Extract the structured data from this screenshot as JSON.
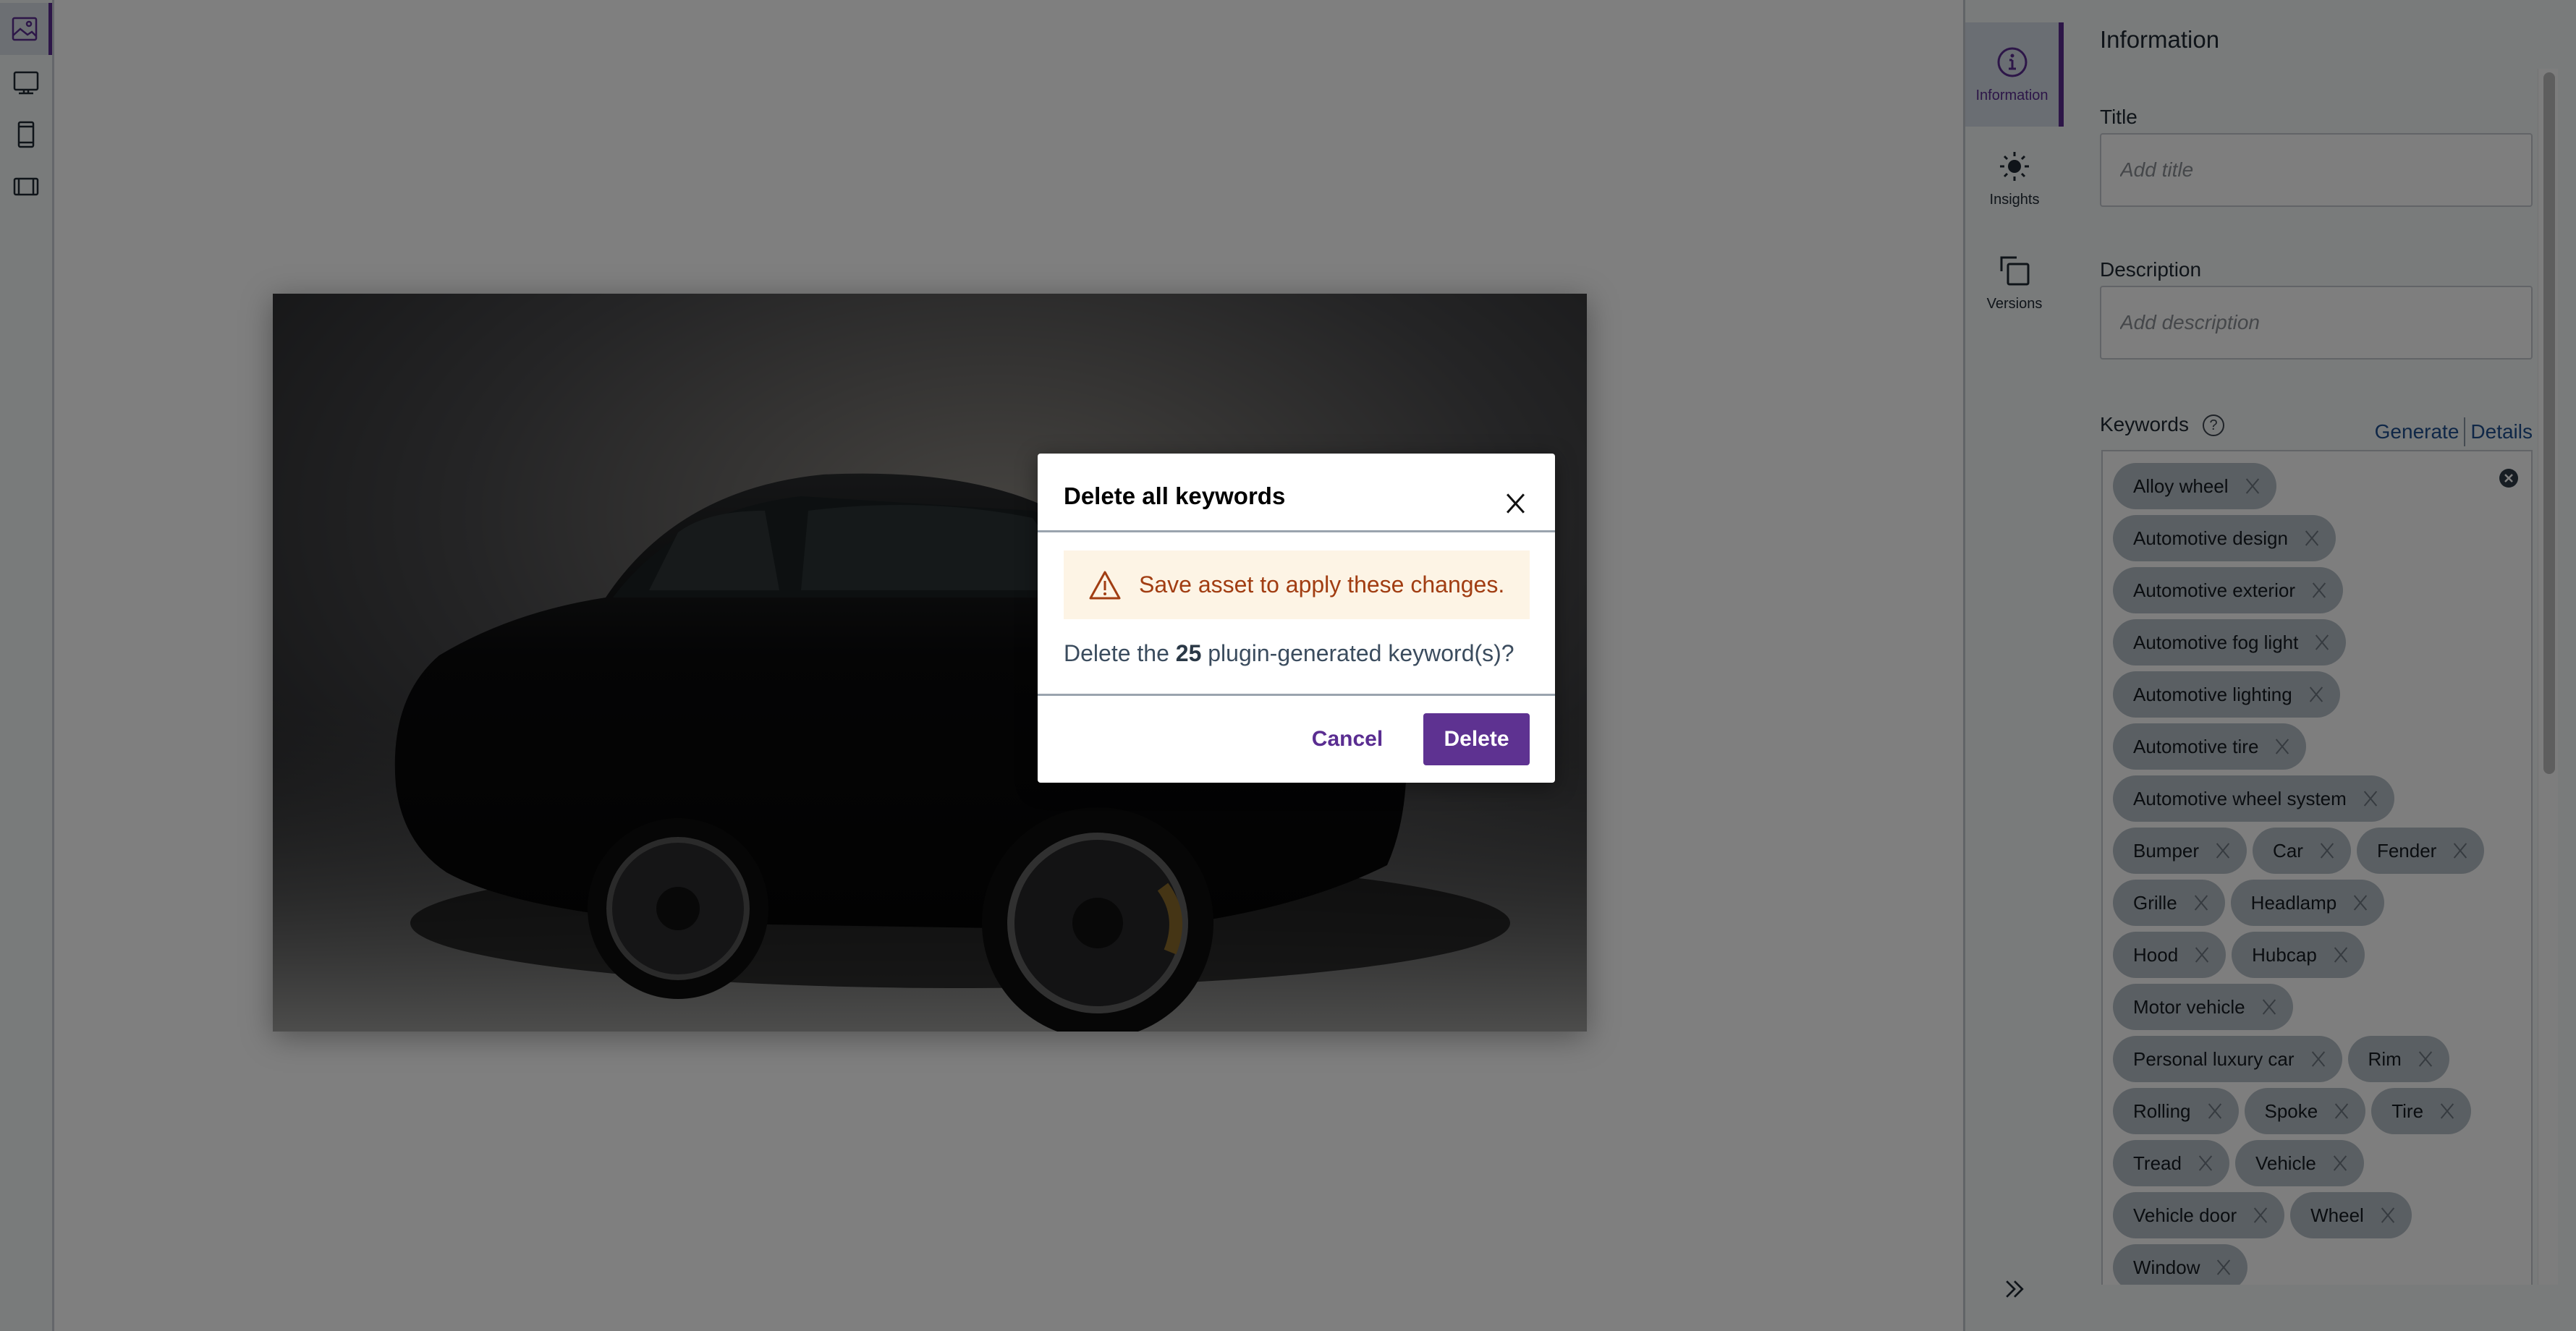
{
  "left_toolbar": {
    "items": [
      {
        "icon": "image-icon",
        "active": true
      },
      {
        "icon": "desktop-icon",
        "active": false
      },
      {
        "icon": "tablet-icon",
        "active": false
      },
      {
        "icon": "film-frame-icon",
        "active": false
      }
    ]
  },
  "canvas": {
    "asset_image": {
      "subject": "Black classic sports car on dark studio background"
    }
  },
  "rail": {
    "items": [
      {
        "label": "Information",
        "icon": "info-icon",
        "active": true
      },
      {
        "label": "Insights",
        "icon": "sun-icon",
        "active": false
      },
      {
        "label": "Versions",
        "icon": "versions-icon",
        "active": false
      }
    ],
    "collapse_icon": "double-chevron-right-icon"
  },
  "info_panel": {
    "title": "Information",
    "title_field": {
      "label": "Title",
      "value": "",
      "placeholder": "Add title"
    },
    "description_field": {
      "label": "Description",
      "value": "",
      "placeholder": "Add description"
    },
    "keywords": {
      "label": "Keywords",
      "help_icon": "?",
      "generate_label": "Generate",
      "details_label": "Details",
      "items": [
        "Alloy wheel",
        "Automotive design",
        "Automotive exterior",
        "Automotive fog light",
        "Automotive lighting",
        "Automotive tire",
        "Automotive wheel system",
        "Bumper",
        "Car",
        "Fender",
        "Grille",
        "Headlamp",
        "Hood",
        "Hubcap",
        "Motor vehicle",
        "Personal luxury car",
        "Rim",
        "Rolling",
        "Spoke",
        "Tire",
        "Tread",
        "Vehicle",
        "Vehicle door",
        "Wheel",
        "Window"
      ]
    }
  },
  "dialog": {
    "title": "Delete all keywords",
    "warning": "Save asset to apply these changes.",
    "body_prefix": "Delete the ",
    "count": "25",
    "body_suffix": " plugin-generated keyword(s)?",
    "cancel_label": "Cancel",
    "delete_label": "Delete"
  },
  "colors": {
    "accent": "#5e3291",
    "warning_bg": "#fdf4e5",
    "warning_text": "#a13d12",
    "link": "#1f4e8f"
  }
}
